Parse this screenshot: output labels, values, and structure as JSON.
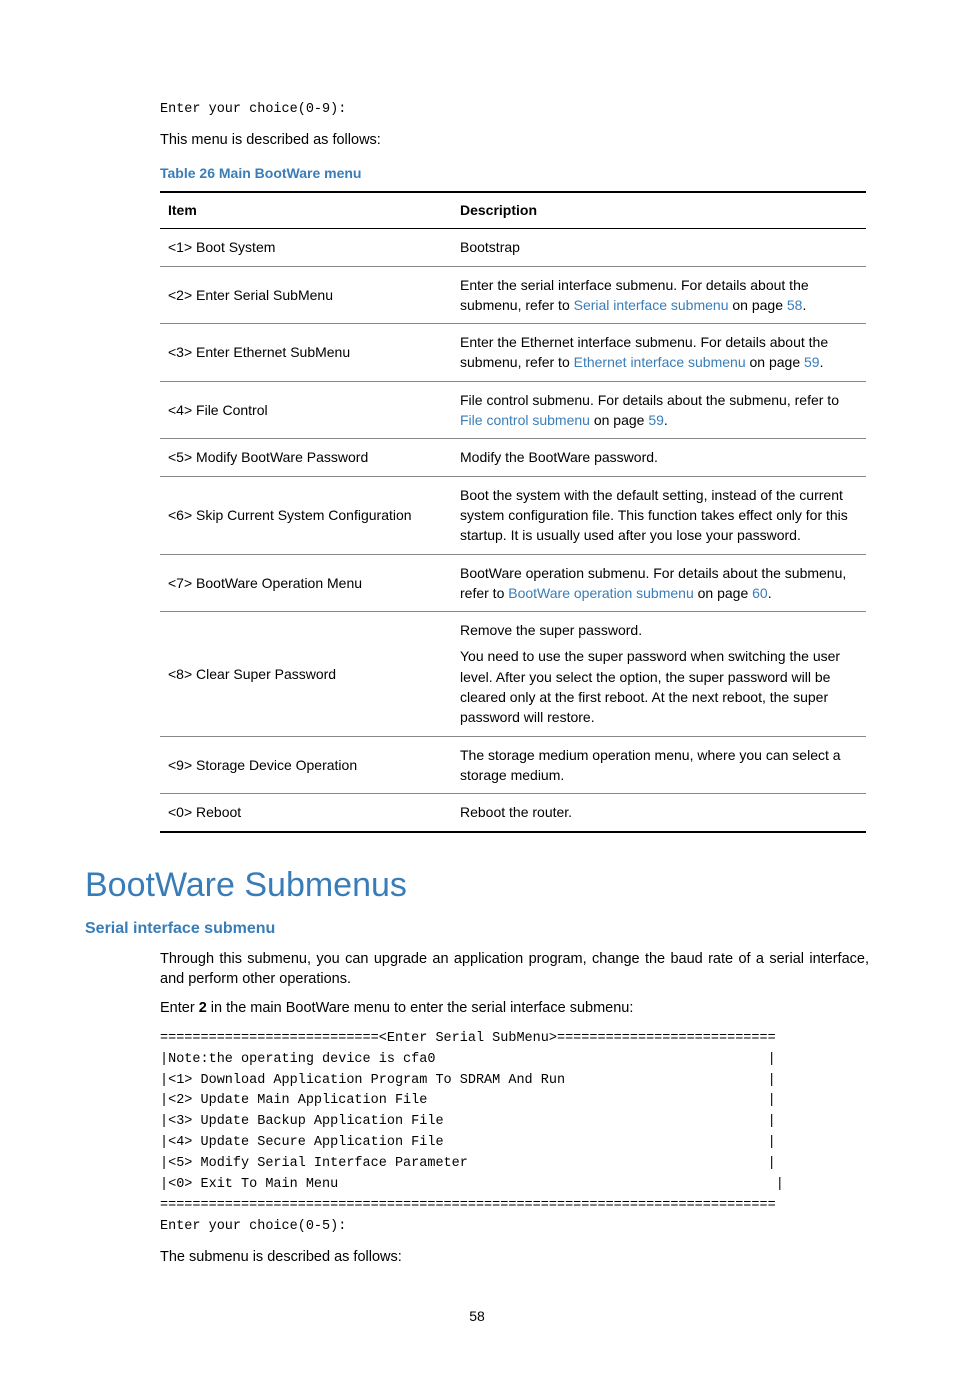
{
  "prompt_top": "Enter your choice(0-9):",
  "intro_para": "This menu is described as follows:",
  "table_caption": "Table 26 Main BootWare menu",
  "table": {
    "headers": [
      "Item",
      "Description"
    ],
    "rows": [
      {
        "item": "<1> Boot System",
        "desc_pre": "Bootstrap",
        "link": "",
        "desc_post": ""
      },
      {
        "item": "<2> Enter Serial SubMenu",
        "desc_pre": "Enter the serial interface submenu. For details about the submenu, refer to ",
        "link": "Serial interface submenu",
        "desc_post": " on page ",
        "page": "58",
        "tail": "."
      },
      {
        "item": "<3> Enter Ethernet SubMenu",
        "desc_pre": "Enter the Ethernet interface submenu. For details about the submenu, refer to ",
        "link": "Ethernet interface submenu",
        "desc_post": " on page ",
        "page": "59",
        "tail": "."
      },
      {
        "item": "<4> File Control",
        "desc_pre": "File control submenu. For details about the submenu, refer to ",
        "link": "File control submenu",
        "desc_post": " on page ",
        "page": "59",
        "tail": "."
      },
      {
        "item": "<5> Modify BootWare Password",
        "desc_pre": "Modify the BootWare password.",
        "link": "",
        "desc_post": ""
      },
      {
        "item": "<6> Skip Current System Configuration",
        "desc_pre": "Boot the system with the default setting, instead of the current system configuration file. This function takes effect only for this startup. It is usually used after you lose your password.",
        "link": "",
        "desc_post": ""
      },
      {
        "item": "<7> BootWare Operation Menu",
        "desc_pre": "BootWare operation submenu. For details about the submenu, refer to ",
        "link": "BootWare operation submenu",
        "desc_post": " on page ",
        "page": "60",
        "tail": "."
      },
      {
        "item": "<8> Clear Super Password",
        "desc_pre": "Remove the super password.",
        "link": "",
        "desc_post": "",
        "para2": "You need to use the super password when switching the user level. After you select the option, the super password will be cleared only at the first reboot. At the next reboot, the super password will restore."
      },
      {
        "item": "<9> Storage Device Operation",
        "desc_pre": "The storage medium operation menu, where you can select a storage medium.",
        "link": "",
        "desc_post": ""
      },
      {
        "item": "<0> Reboot",
        "desc_pre": "Reboot the router.",
        "link": "",
        "desc_post": ""
      }
    ]
  },
  "section_heading": "BootWare Submenus",
  "sub_heading": "Serial interface submenu",
  "sub_para": "Through this submenu, you can upgrade an application program, change the baud rate of a serial interface, and perform other operations.",
  "enter_para_pre": "Enter ",
  "enter_para_num": "2",
  "enter_para_post": " in the main BootWare menu to enter the serial interface submenu:",
  "submenu_block": "===========================<Enter Serial SubMenu>===========================\n|Note:the operating device is cfa0                                         |\n|<1> Download Application Program To SDRAM And Run                         |\n|<2> Update Main Application File                                          |\n|<3> Update Backup Application File                                        |\n|<4> Update Secure Application File                                        |\n|<5> Modify Serial Interface Parameter                                     |\n|<0> Exit To Main Menu                                                      |\n============================================================================\nEnter your choice(0-5):",
  "closing_para": "The submenu is described as follows:",
  "page_number": "58"
}
